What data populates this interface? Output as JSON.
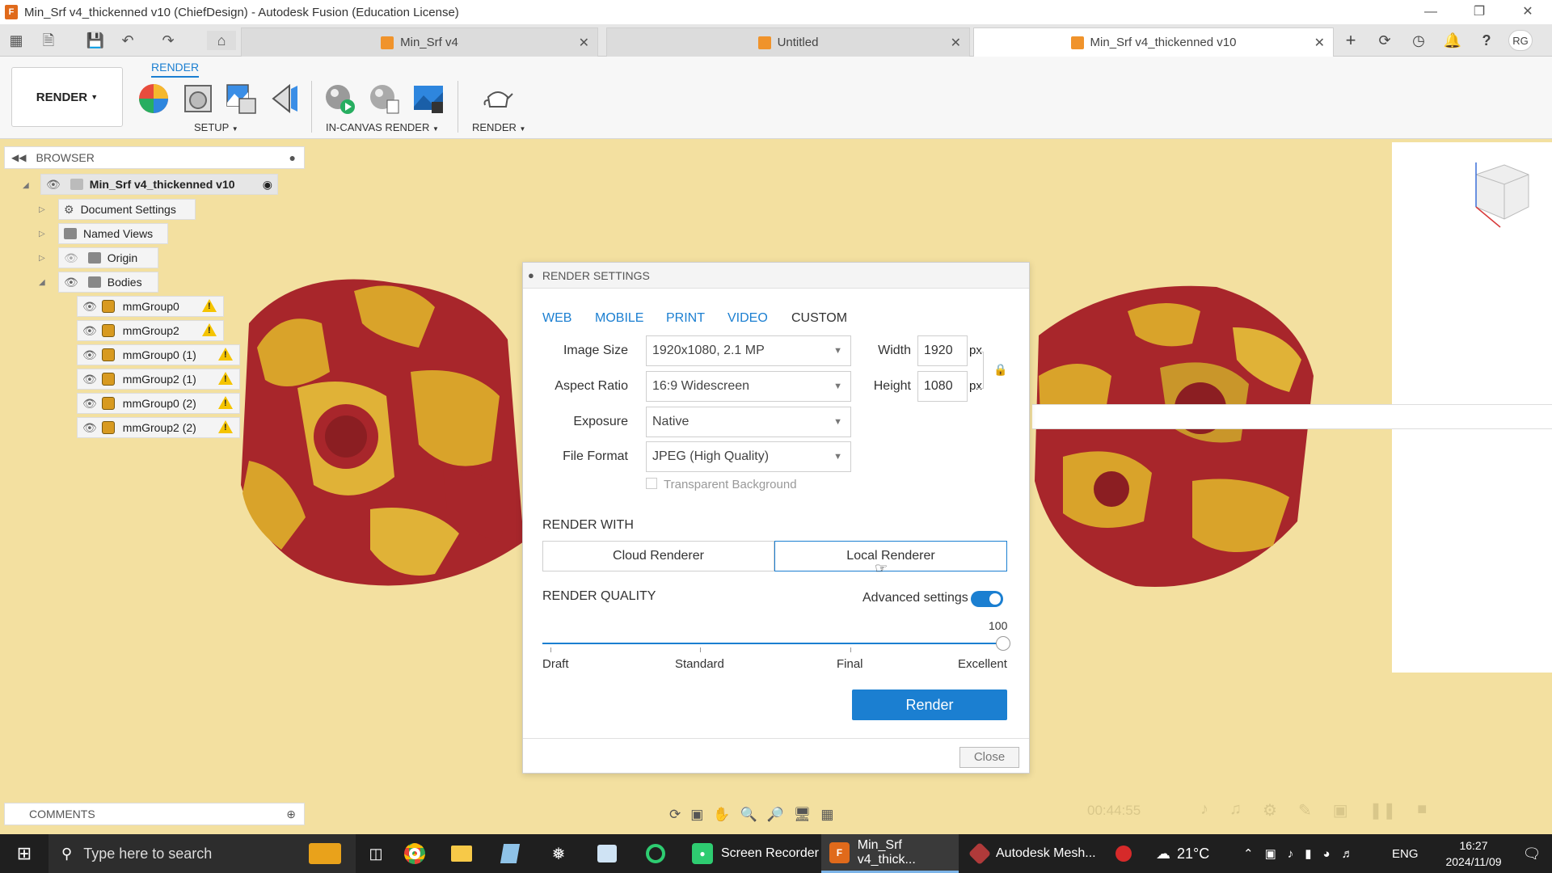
{
  "window": {
    "title": "Min_Srf v4_thickenned v10 (ChiefDesign) - Autodesk Fusion (Education License)"
  },
  "tabs": [
    {
      "label": "Min_Srf v4"
    },
    {
      "label": "Untitled"
    },
    {
      "label": "Min_Srf v4_thickenned v10"
    }
  ],
  "user_initials": "RG",
  "toolbar": {
    "workspace": "RENDER",
    "active_tab": "RENDER",
    "groups": [
      "SETUP",
      "IN-CANVAS RENDER",
      "RENDER"
    ]
  },
  "browser": {
    "title": "BROWSER",
    "root": "Min_Srf v4_thickenned v10",
    "items": [
      "Document Settings",
      "Named Views",
      "Origin",
      "Bodies"
    ],
    "bodies": [
      "mmGroup0",
      "mmGroup2",
      "mmGroup0 (1)",
      "mmGroup2 (1)",
      "mmGroup0 (2)",
      "mmGroup2 (2)"
    ]
  },
  "dialog": {
    "title": "RENDER SETTINGS",
    "presets": [
      "WEB",
      "MOBILE",
      "PRINT",
      "VIDEO",
      "CUSTOM"
    ],
    "image_size_label": "Image Size",
    "image_size": "1920x1080, 2.1 MP",
    "aspect_ratio_label": "Aspect Ratio",
    "aspect_ratio": "16:9 Widescreen",
    "exposure_label": "Exposure",
    "exposure": "Native",
    "file_format_label": "File Format",
    "file_format": "JPEG (High Quality)",
    "transparent_bg": "Transparent Background",
    "width_label": "Width",
    "width": "1920",
    "height_label": "Height",
    "height": "1080",
    "unit": "px",
    "render_with": "RENDER WITH",
    "cloud_renderer": "Cloud Renderer",
    "local_renderer": "Local Renderer",
    "render_quality": "RENDER QUALITY",
    "advanced_settings": "Advanced settings",
    "quality_value": "100",
    "quality_fraction": 1.0,
    "quality_marks": [
      "Draft",
      "Standard",
      "Final",
      "Excellent"
    ],
    "render_button": "Render",
    "close_button": "Close"
  },
  "comments": {
    "title": "COMMENTS"
  },
  "playback": {
    "time": "00:44:55"
  },
  "taskbar": {
    "search_placeholder": "Type here to search",
    "apps": [
      "Screen Recorder",
      "Min_Srf v4_thick...",
      "Autodesk Mesh..."
    ],
    "temperature": "21°C",
    "language": "ENG",
    "time": "16:27",
    "date": "2024/11/09"
  },
  "colors": {
    "accent": "#1b7fd1",
    "viewport_bg": "#f3e0a0",
    "model_gold": "#d9a32a",
    "model_red": "#a8262b"
  }
}
